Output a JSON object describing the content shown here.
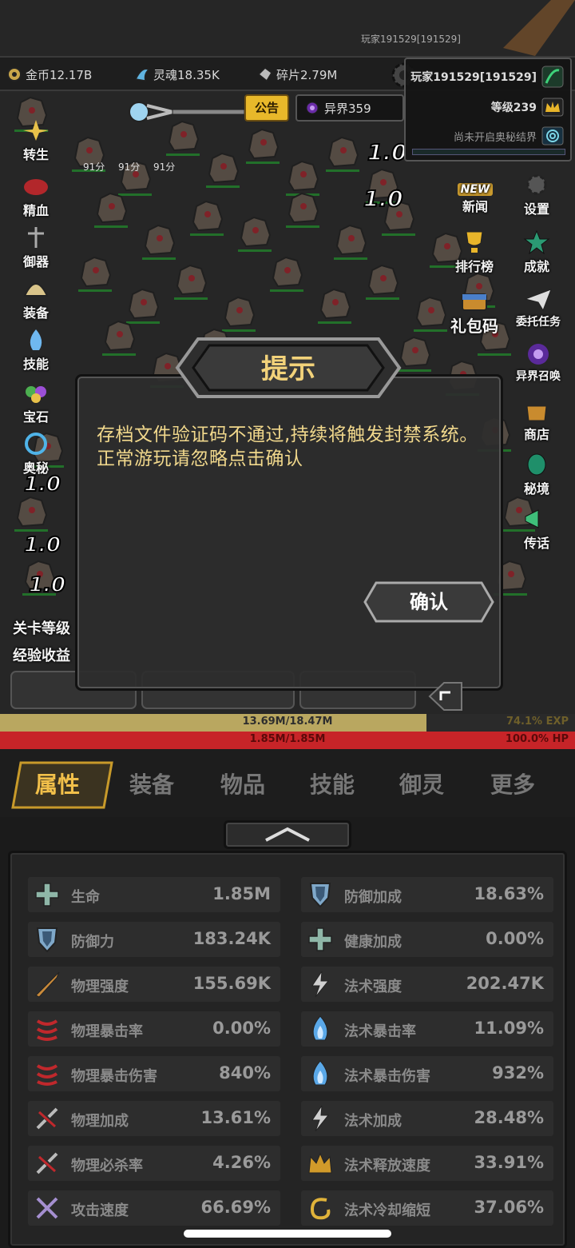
{
  "top": {
    "username_small": "玩家191529[191529]"
  },
  "resources": {
    "gold": "金币12.17B",
    "soul": "灵魂18.35K",
    "shard": "碎片2.79M"
  },
  "player": {
    "name": "玩家191529[191529]",
    "level": "等级239",
    "secret": "尚未开启奥秘结界"
  },
  "notice_label": "公告",
  "otherworld": "异界359",
  "float_texts": [
    "91分",
    "91分",
    "91分"
  ],
  "left_menu": [
    "转生",
    "精血",
    "御器",
    "装备",
    "技能",
    "宝石",
    "奥秘"
  ],
  "right_menu": [
    "新闻",
    "设置",
    "排行榜",
    "成就",
    "礼包码",
    "委托任务",
    "异界召唤",
    "商店",
    "秘境",
    "传话"
  ],
  "new_badge": "NEW",
  "left_info": [
    "关卡等级",
    "经验收益"
  ],
  "dialog": {
    "title": "提示",
    "message": "存档文件验证码不通过,持续将触发封禁系统。正常游玩请忽略点击确认",
    "confirm": "确认"
  },
  "exp_bar": {
    "text": "13.69M/18.47M",
    "percent_text": "74.1% EXP",
    "fill": 0.741
  },
  "hp_bar": {
    "text": "1.85M/1.85M",
    "percent_text": "100.0%  HP",
    "fill": 1.0
  },
  "tabs": [
    "属性",
    "装备",
    "物品",
    "技能",
    "御灵",
    "更多"
  ],
  "active_tab": "属性",
  "stats_left": [
    {
      "name": "生命",
      "value": "1.85M",
      "icon": "cross-icon"
    },
    {
      "name": "防御力",
      "value": "183.24K",
      "icon": "shield-icon"
    },
    {
      "name": "物理强度",
      "value": "155.69K",
      "icon": "sword-icon"
    },
    {
      "name": "物理暴击率",
      "value": "0.00%",
      "icon": "slash-icon"
    },
    {
      "name": "物理暴击伤害",
      "value": "840%",
      "icon": "slash-icon"
    },
    {
      "name": "物理加成",
      "value": "13.61%",
      "icon": "broken-sword-icon"
    },
    {
      "name": "物理必杀率",
      "value": "4.26%",
      "icon": "broken-sword-icon"
    },
    {
      "name": "攻击速度",
      "value": "66.69%",
      "icon": "crossed-swords-icon"
    }
  ],
  "stats_right": [
    {
      "name": "防御加成",
      "value": "18.63%",
      "icon": "shield-icon"
    },
    {
      "name": "健康加成",
      "value": "0.00%",
      "icon": "cross-icon"
    },
    {
      "name": "法术强度",
      "value": "202.47K",
      "icon": "lightning-icon"
    },
    {
      "name": "法术暴击率",
      "value": "11.09%",
      "icon": "flame-icon"
    },
    {
      "name": "法术暴击伤害",
      "value": "932%",
      "icon": "flame-icon"
    },
    {
      "name": "法术加成",
      "value": "28.48%",
      "icon": "lightning-icon"
    },
    {
      "name": "法术释放速度",
      "value": "33.91%",
      "icon": "crown-icon"
    },
    {
      "name": "法术冷却缩短",
      "value": "37.06%",
      "icon": "swirl-icon"
    }
  ],
  "colors": {
    "exp": "#b9a760",
    "hp": "#c72428",
    "accent": "#f2c04a",
    "dialog_text": "#f1d88c"
  }
}
